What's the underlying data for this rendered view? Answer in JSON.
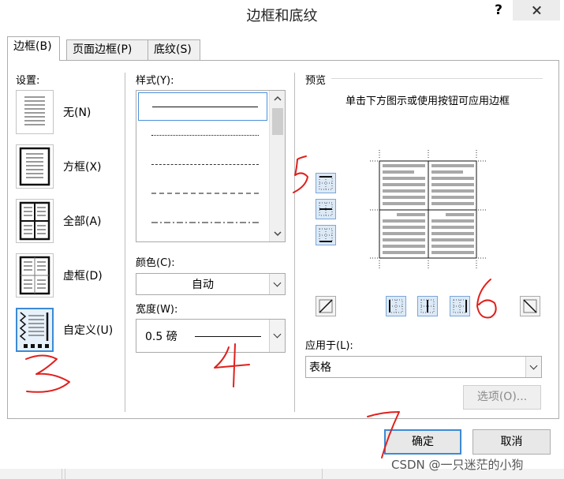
{
  "dialog": {
    "title": "边框和底纹",
    "help_label": "?",
    "close_icon": "close-icon"
  },
  "tabs": [
    {
      "label": "边框(B)",
      "active": true
    },
    {
      "label": "页面边框(P)",
      "active": false
    },
    {
      "label": "底纹(S)",
      "active": false
    }
  ],
  "settings": {
    "label": "设置:",
    "items": [
      {
        "label": "无(N)",
        "icon": "border-none-icon",
        "selected": false
      },
      {
        "label": "方框(X)",
        "icon": "border-box-icon",
        "selected": false
      },
      {
        "label": "全部(A)",
        "icon": "border-all-icon",
        "selected": false
      },
      {
        "label": "虚框(D)",
        "icon": "border-grid-icon",
        "selected": false
      },
      {
        "label": "自定义(U)",
        "icon": "border-custom-icon",
        "selected": true
      }
    ]
  },
  "style": {
    "label": "样式(Y):",
    "options": [
      "solid",
      "dotted",
      "dashed-small",
      "dashed",
      "dash-dot"
    ],
    "selected_index": 0
  },
  "color": {
    "label": "颜色(C):",
    "value": "自动"
  },
  "width": {
    "label": "宽度(W):",
    "value": "0.5 磅"
  },
  "preview": {
    "label": "预览",
    "hint": "单击下方图示或使用按钮可应用边框",
    "left_buttons": [
      "border-top-icon",
      "border-inside-horizontal-icon",
      "border-bottom-icon"
    ],
    "bottom_buttons": [
      "diagonal-up-icon",
      "border-left-icon",
      "border-inside-vertical-icon",
      "border-right-icon",
      "diagonal-down-icon"
    ]
  },
  "apply_to": {
    "label": "应用于(L):",
    "value": "表格"
  },
  "buttons": {
    "options": "选项(O)...",
    "ok": "确定",
    "cancel": "取消"
  },
  "annotations": [
    "3",
    "4",
    "5",
    "6",
    "7"
  ],
  "annotation_color": "#e0201c",
  "accent_color": "#3c8ad5",
  "watermark": "CSDN @一只迷茫的小狗"
}
